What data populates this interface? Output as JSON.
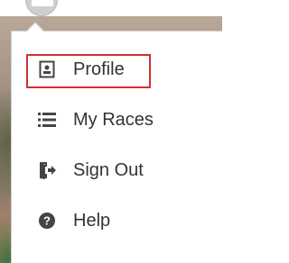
{
  "menu": {
    "items": [
      {
        "label": "Profile",
        "icon": "profile-icon"
      },
      {
        "label": "My Races",
        "icon": "list-icon"
      },
      {
        "label": "Sign Out",
        "icon": "sign-out-icon"
      },
      {
        "label": "Help",
        "icon": "help-icon"
      }
    ]
  },
  "colors": {
    "text": "#333333",
    "icon": "#444444",
    "highlight": "#d32f2f"
  }
}
